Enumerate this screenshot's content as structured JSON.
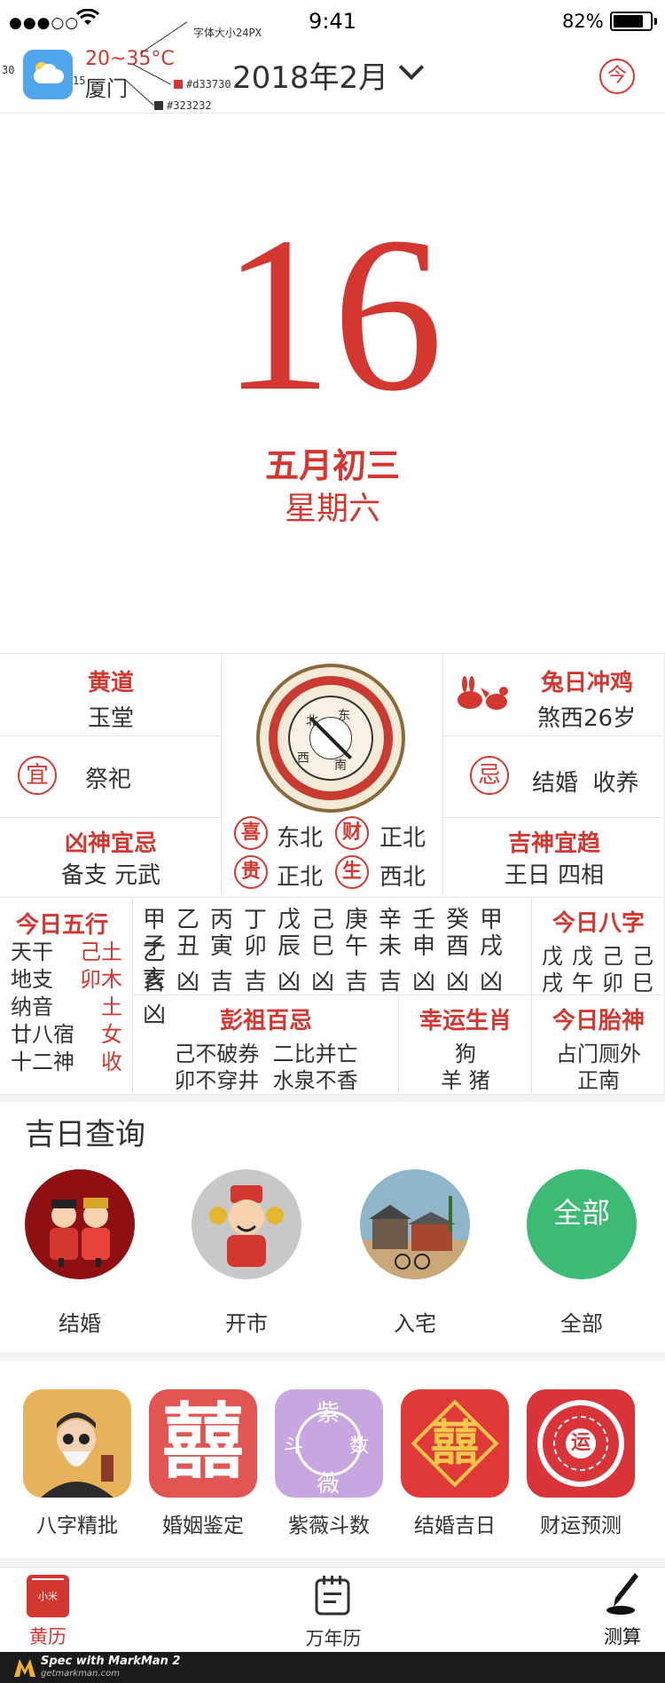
{
  "status_bar": {
    "signal": "●●●○○",
    "time": "9:41",
    "battery_pct": "82%",
    "battery_level": 0.82
  },
  "header": {
    "weather_icon": "partly-cloudy-icon",
    "temperature": "20~35°C",
    "city": "厦门",
    "month_title": "2018年2月",
    "today_button": "今"
  },
  "spec_annotations": {
    "font_note": "字体大小24PX",
    "color_red": "#d33730",
    "color_dark": "#323232",
    "dim_30": "30",
    "dim_15": "15"
  },
  "hero": {
    "day": "16",
    "lunar_date": "五月初三",
    "weekday": "星期六"
  },
  "almanac": {
    "huangdao_title": "黄道",
    "huangdao_value": "玉堂",
    "yi_seal": "宜",
    "yi_value": "祭祀",
    "xiongshen_title": "凶神宜忌",
    "xiongshen_value": "备支 元武",
    "chong_title": "兔日冲鸡",
    "chong_value": "煞西26岁",
    "ji_seal": "忌",
    "ji_value": "结婚  收养",
    "jishen_title": "吉神宜趋",
    "jishen_value": "王日 四相",
    "directions": [
      {
        "tag": "喜",
        "dir": "东北"
      },
      {
        "tag": "财",
        "dir": "正北"
      },
      {
        "tag": "贵",
        "dir": "正北"
      },
      {
        "tag": "生",
        "dir": "西北"
      }
    ],
    "compass_chars": [
      "东",
      "北",
      "西",
      "南"
    ],
    "wuxing": {
      "title": "今日五行",
      "rows": [
        {
          "label": "天干",
          "value": "己土"
        },
        {
          "label": "地支",
          "value": "卯木"
        },
        {
          "label": "纳音",
          "value": "土"
        },
        {
          "label": "廿八宿",
          "value": "女"
        },
        {
          "label": "十二神",
          "value": "收"
        }
      ]
    },
    "hours": {
      "stems": [
        "甲",
        "乙",
        "丙",
        "丁",
        "戊",
        "己",
        "庚",
        "辛",
        "壬",
        "癸",
        "甲",
        "乙"
      ],
      "branches": [
        "子",
        "丑",
        "寅",
        "卯",
        "辰",
        "巳",
        "午",
        "未",
        "申",
        "酉",
        "戌",
        "亥"
      ],
      "luck": [
        "吉",
        "凶",
        "吉",
        "吉",
        "凶",
        "凶",
        "吉",
        "吉",
        "凶",
        "凶",
        "凶",
        "凶"
      ]
    },
    "bazi": {
      "title": "今日八字",
      "row1": [
        "戊",
        "戊",
        "己",
        "己"
      ],
      "row2": [
        "戌",
        "午",
        "卯",
        "巳"
      ]
    },
    "pengzu": {
      "title": "彭祖百忌",
      "line1": "己不破券  二比并亡",
      "line2": "卯不穿井  水泉不香"
    },
    "lucky_zodiac": {
      "title": "幸运生肖",
      "line1": "狗",
      "line2": "羊 猪"
    },
    "taishen": {
      "title": "今日胎神",
      "line1": "占门厕外",
      "line2": "正南"
    }
  },
  "jiri": {
    "title": "吉日查询",
    "items": [
      {
        "label": "结婚",
        "icon": "wedding-couple-icon"
      },
      {
        "label": "开市",
        "icon": "god-of-wealth-icon"
      },
      {
        "label": "入宅",
        "icon": "house-move-icon"
      },
      {
        "label": "全部",
        "icon_text": "全部"
      }
    ]
  },
  "services": [
    {
      "label": "八字精批",
      "icon": "fortune-teller-icon"
    },
    {
      "label": "婚姻鉴定",
      "icon": "double-happiness-icon",
      "glyph": "囍"
    },
    {
      "label": "紫薇斗数",
      "icon": "ziwei-chart-icon",
      "chars": [
        "紫",
        "数",
        "薇",
        "斗"
      ]
    },
    {
      "label": "结婚吉日",
      "icon": "wedding-date-icon",
      "glyph": "囍"
    },
    {
      "label": "财运预测",
      "icon": "wealth-bagua-icon",
      "glyph": "运"
    }
  ],
  "tabs": [
    {
      "label": "黄历",
      "icon": "almanac-icon",
      "badge": "小米",
      "active": true
    },
    {
      "label": "万年历",
      "icon": "calendar-icon",
      "active": false
    },
    {
      "label": "测算",
      "icon": "brush-icon",
      "active": false
    }
  ],
  "footer": {
    "brand": "Spec with MarkMan 2",
    "url": "getmarkman.com"
  },
  "colors": {
    "accent": "#d33730",
    "text": "#323232",
    "divider": "#e6e6e6",
    "quanbu_green": "#3dbb74"
  }
}
